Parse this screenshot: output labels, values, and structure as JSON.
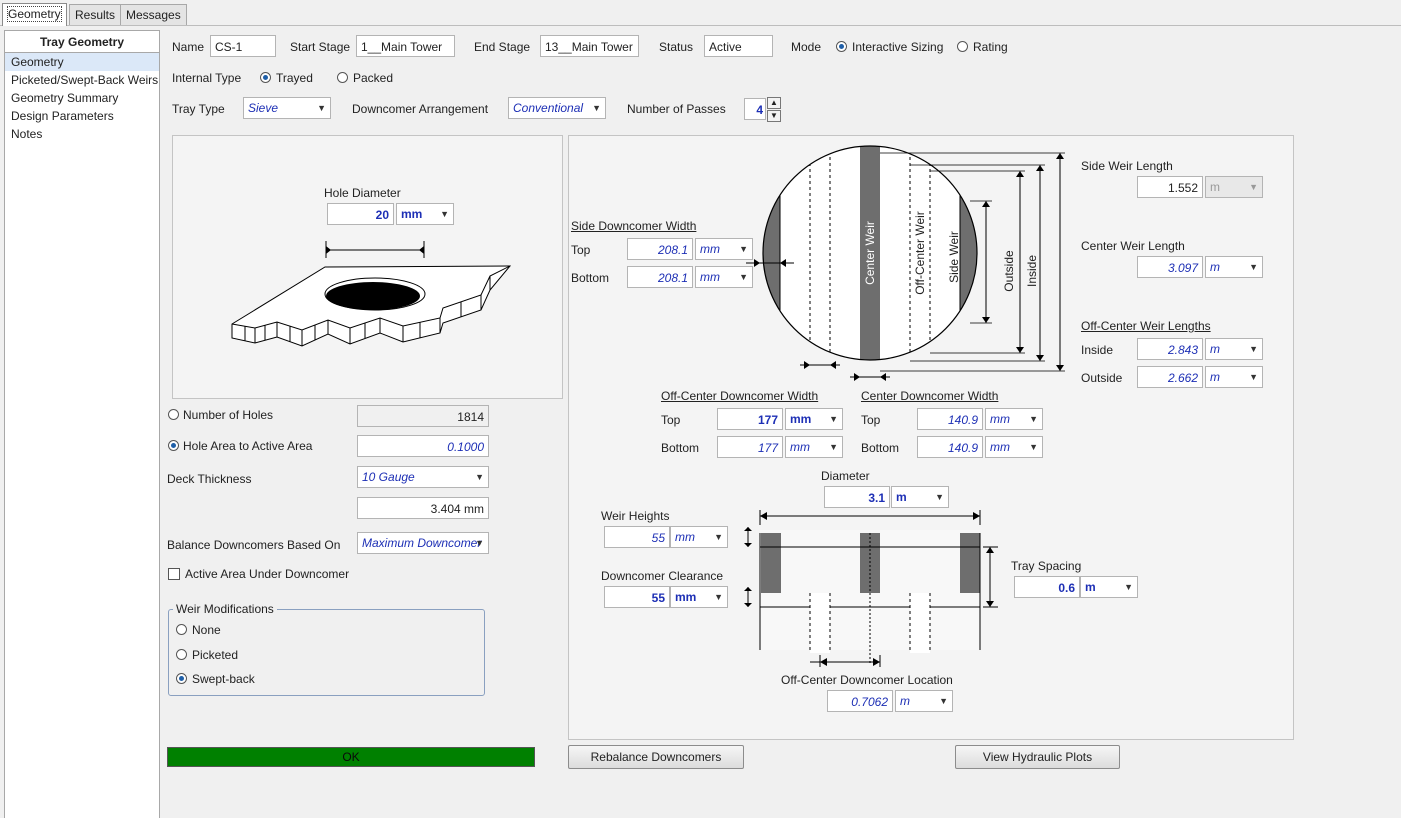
{
  "tabs": [
    "Geometry",
    "Results",
    "Messages"
  ],
  "sidebar": {
    "title": "Tray Geometry",
    "items": [
      "Geometry",
      "Picketed/Swept-Back Weirs",
      "Geometry Summary",
      "Design Parameters",
      "Notes"
    ]
  },
  "header": {
    "name_label": "Name",
    "name_value": "CS-1",
    "start_stage_label": "Start Stage",
    "start_stage_value": "1__Main Tower",
    "end_stage_label": "End Stage",
    "end_stage_value": "13__Main Tower",
    "status_label": "Status",
    "status_value": "Active",
    "mode_label": "Mode",
    "mode_interactive": "Interactive Sizing",
    "mode_rating": "Rating",
    "internal_type_label": "Internal Type",
    "internal_trayed": "Trayed",
    "internal_packed": "Packed",
    "tray_type_label": "Tray Type",
    "tray_type_value": "Sieve",
    "dc_arrangement_label": "Downcomer Arrangement",
    "dc_arrangement_value": "Conventional",
    "passes_label": "Number of Passes",
    "passes_value": "4"
  },
  "hole": {
    "diameter_label": "Hole Diameter",
    "diameter_value": "20",
    "diameter_unit": "mm"
  },
  "left": {
    "num_holes_label": "Number of Holes",
    "num_holes_value": "1814",
    "hole_area_label": "Hole Area to Active Area",
    "hole_area_value": "0.1000",
    "deck_label": "Deck Thickness",
    "deck_gauge": "10 Gauge",
    "deck_value": "3.404 mm",
    "balance_label": "Balance Downcomers Based On",
    "balance_value": "Maximum Downcomer",
    "active_area_label": "Active Area Under Downcomer",
    "weir_mod_title": "Weir Modifications",
    "weir_none": "None",
    "weir_picketed": "Picketed",
    "weir_swept": "Swept-back",
    "ok_status": "OK"
  },
  "diagram": {
    "center_weir": "Center Weir",
    "off_center_weir": "Off-Center Weir",
    "side_weir": "Side Weir",
    "outside": "Outside",
    "inside": "Inside"
  },
  "side_dc": {
    "title": "Side Downcomer Width",
    "top_label": "Top",
    "top_value": "208.1",
    "top_unit": "mm",
    "bottom_label": "Bottom",
    "bottom_value": "208.1",
    "bottom_unit": "mm"
  },
  "side_weir": {
    "label": "Side Weir Length",
    "value": "1.552",
    "unit": "m"
  },
  "center_weir": {
    "label": "Center Weir Length",
    "value": "3.097",
    "unit": "m"
  },
  "off_center_weir": {
    "title": "Off-Center Weir Lengths",
    "inside_label": "Inside",
    "inside_value": "2.843",
    "inside_unit": "m",
    "outside_label": "Outside",
    "outside_value": "2.662",
    "outside_unit": "m"
  },
  "off_center_dc": {
    "title": "Off-Center Downcomer Width",
    "top_label": "Top",
    "top_value": "177",
    "top_unit": "mm",
    "bottom_label": "Bottom",
    "bottom_value": "177",
    "bottom_unit": "mm"
  },
  "center_dc": {
    "title": "Center Downcomer Width",
    "top_label": "Top",
    "top_value": "140.9",
    "top_unit": "mm",
    "bottom_label": "Bottom",
    "bottom_value": "140.9",
    "bottom_unit": "mm"
  },
  "diameter": {
    "label": "Diameter",
    "value": "3.1",
    "unit": "m"
  },
  "weir_heights": {
    "label": "Weir Heights",
    "value": "55",
    "unit": "mm"
  },
  "dc_clearance": {
    "label": "Downcomer Clearance",
    "value": "55",
    "unit": "mm"
  },
  "tray_spacing": {
    "label": "Tray Spacing",
    "value": "0.6",
    "unit": "m"
  },
  "off_center_loc": {
    "label": "Off-Center Downcomer Location",
    "value": "0.7062",
    "unit": "m"
  },
  "buttons": {
    "rebalance": "Rebalance Downcomers",
    "hydraulic": "View Hydraulic Plots"
  }
}
